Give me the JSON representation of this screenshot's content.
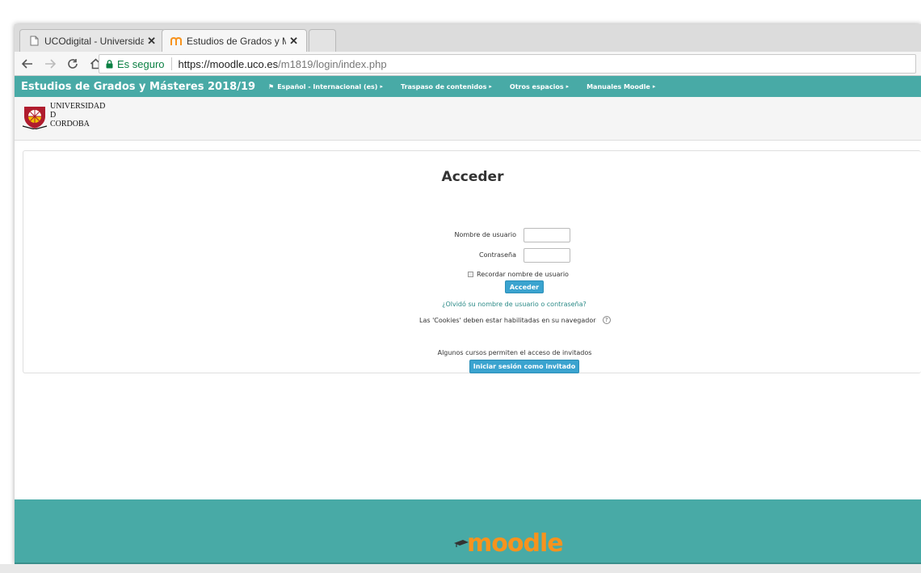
{
  "browser": {
    "tabs": [
      {
        "title": "UCOdigital - Universidad",
        "active": false
      },
      {
        "title": "Estudios de Grados y Má",
        "active": true
      }
    ],
    "close_glyph": "✕",
    "secure_label": "Es seguro",
    "url_host": "https://moodle.uco.es",
    "url_path": "/m1819/login/index.php"
  },
  "navbar": {
    "brand": "Estudios de Grados y Másteres 2018/19",
    "links": [
      {
        "label": "Español - Internacional (es)"
      },
      {
        "label": "Traspaso de contenidos"
      },
      {
        "label": "Otros espacios"
      },
      {
        "label": "Manuales Moodle"
      }
    ],
    "color": "#48aaa6"
  },
  "header": {
    "logo_lines": [
      "UNIVERSIDAD",
      "D",
      "CORDOBA"
    ]
  },
  "login": {
    "title": "Acceder",
    "username_label": "Nombre de usuario",
    "password_label": "Contraseña",
    "username_value": "",
    "password_value": "",
    "remember_label": "Recordar nombre de usuario",
    "submit_label": "Acceder",
    "forgot_link": "¿Olvidó su nombre de usuario o contraseña?",
    "cookies_note": "Las 'Cookies' deben estar habilitadas en su navegador",
    "guest_note": "Algunos cursos permiten el acceso de invitados",
    "guest_button": "Iniciar sesión como invitado",
    "button_color": "#3aa3cf"
  },
  "footer": {
    "logo_text": "moodle",
    "logo_color": "#f7931e"
  }
}
